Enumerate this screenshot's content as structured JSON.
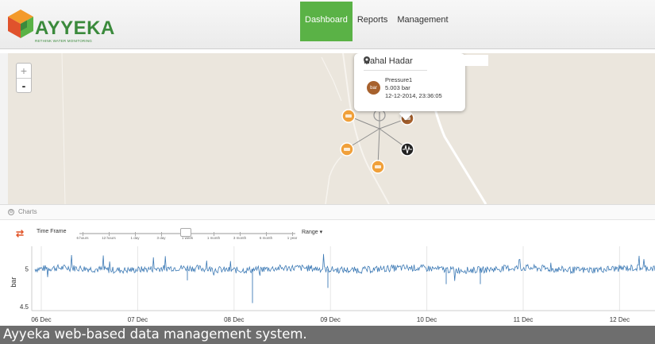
{
  "header": {
    "brand": "AYYEKA",
    "tagline": "RETHINK WATER MONITORING",
    "nav": [
      {
        "label": "Dashboard",
        "active": true
      },
      {
        "label": "Reports",
        "active": false
      },
      {
        "label": "Management",
        "active": false
      }
    ]
  },
  "map": {
    "zoom_in": "+",
    "zoom_out": "-",
    "marker_icons": [
      "gauge-icon",
      "pin-icon",
      "seismograph-icon"
    ],
    "popup": {
      "title": "Nahal Hadar",
      "badge": "bar",
      "sensor_name": "Pressure1",
      "value": "5.003 bar",
      "timestamp": "12-12-2014, 23:36:05"
    }
  },
  "charts": {
    "panel_label": "Charts",
    "time_frame_label": "Time Frame",
    "time_frame_ticks": [
      "6 hours",
      "12 hours",
      "1 day",
      "3 day",
      "1 week",
      "1 month",
      "3 month",
      "6 month",
      "1 year"
    ],
    "time_frame_selected": "1 week",
    "range_label": "Range"
  },
  "chart_data": {
    "type": "line",
    "title": "",
    "xlabel": "",
    "ylabel": "bar",
    "x_tick_labels": [
      "06 Dec",
      "07 Dec",
      "08 Dec",
      "09 Dec",
      "10 Dec",
      "11 Dec",
      "12 Dec"
    ],
    "y_tick_labels": [
      "5",
      "4.5"
    ],
    "ylim": [
      4.45,
      5.3
    ],
    "grid": true,
    "series": [
      {
        "name": "",
        "color": "#3d7ab5",
        "x_start": "06 Dec",
        "x_end": "12 Dec",
        "typical_value": 5.0,
        "min": 4.55,
        "max": 5.2
      }
    ]
  },
  "caption": "Ayyeka web-based data management system.",
  "colors": {
    "brand_green": "#3b8a3c",
    "nav_active": "#5ab246",
    "marker_orange": "#f0a03a",
    "marker_brown": "#a7612d",
    "series_blue": "#3d7ab5",
    "map_bg": "#ebe6dd"
  }
}
